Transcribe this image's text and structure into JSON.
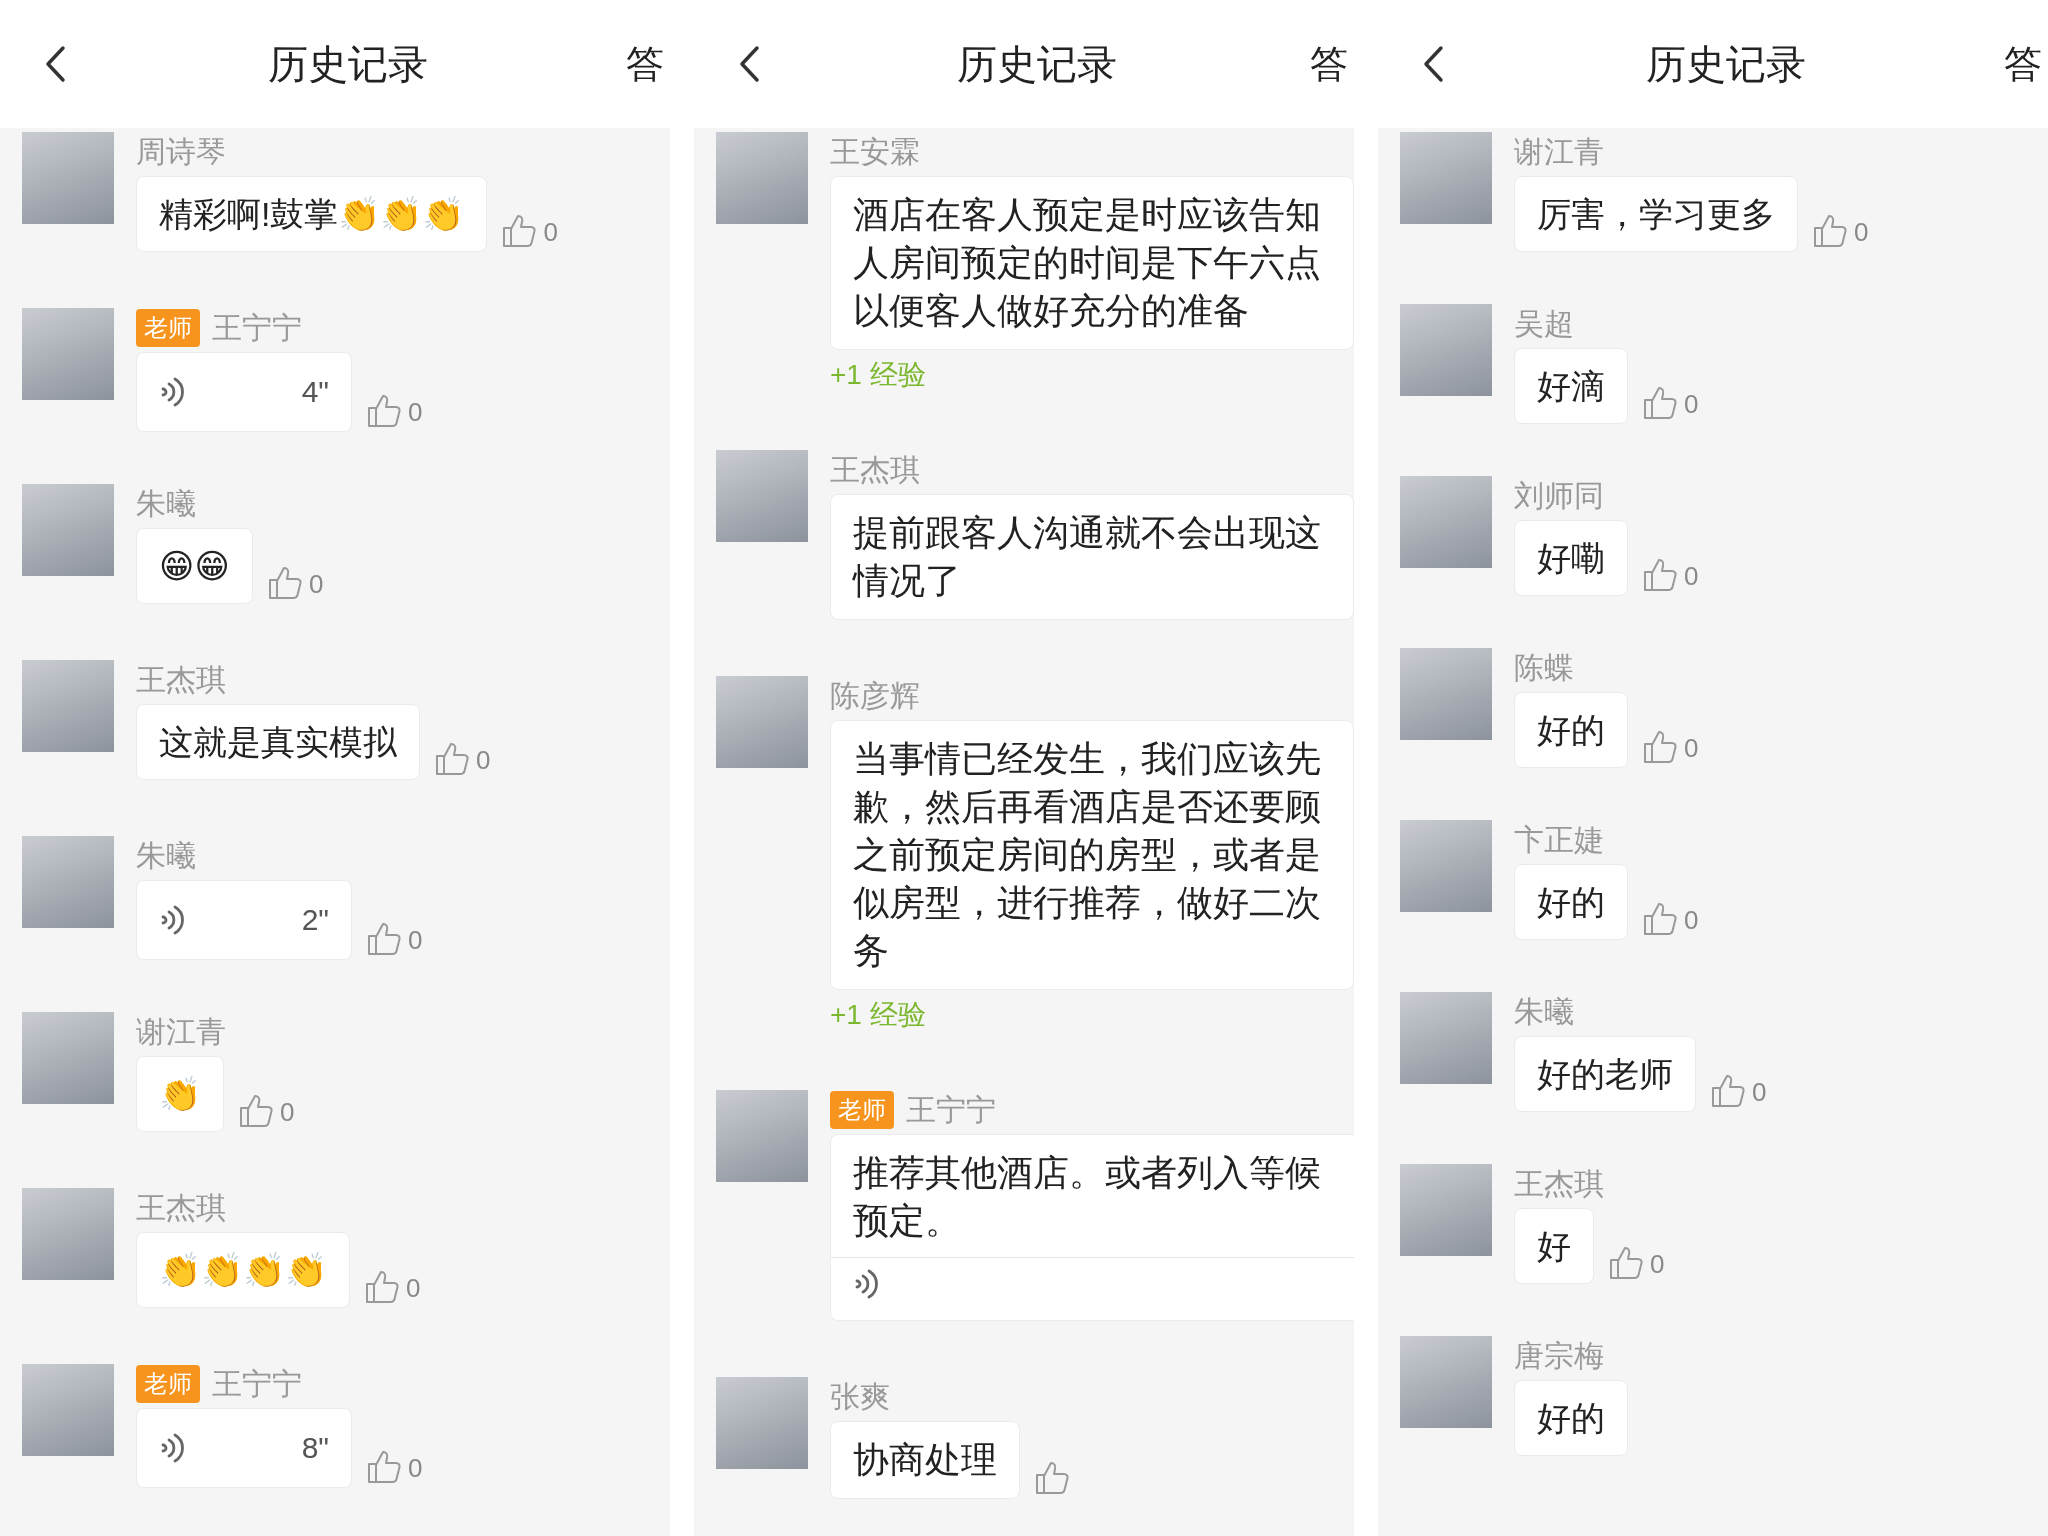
{
  "panels": [
    {
      "title": "历史记录",
      "tab": "答",
      "comments": [
        {
          "name": "周诗琴",
          "kind": "text",
          "text": "精彩啊!鼓掌👏👏👏",
          "like": true,
          "like_count": "0"
        },
        {
          "name": "王宁宁",
          "badge": "老师",
          "kind": "voice",
          "duration": "4\"",
          "like": true,
          "like_count": "0"
        },
        {
          "name": "朱曦",
          "kind": "text",
          "text": "😁😁",
          "like": true,
          "like_count": "0"
        },
        {
          "name": "王杰琪",
          "kind": "text",
          "text": "这就是真实模拟",
          "like": true,
          "like_count": "0"
        },
        {
          "name": "朱曦",
          "kind": "voice",
          "duration": "2\"",
          "like": true,
          "like_count": "0"
        },
        {
          "name": "谢江青",
          "kind": "text",
          "text": "👏",
          "like": true,
          "like_count": "0"
        },
        {
          "name": "王杰琪",
          "kind": "text",
          "text": "👏👏👏👏",
          "like": true,
          "like_count": "0"
        },
        {
          "name": "王宁宁",
          "badge": "老师",
          "kind": "voice",
          "duration": "8\"",
          "like": true,
          "like_count": "0"
        }
      ]
    },
    {
      "title": "历史记录",
      "tab": "答",
      "comments": [
        {
          "name": "王安霖",
          "kind": "text",
          "text": "酒店在客人预定是时应该告知人房间预定的时间是下午六点以便客人做好充分的准备",
          "bonus": "+1 经验",
          "like": false
        },
        {
          "name": "王杰琪",
          "kind": "text",
          "text": "提前跟客人沟通就不会出现这情况了",
          "like": false
        },
        {
          "name": "陈彦辉",
          "kind": "text",
          "text": "当事情已经发生，我们应该先歉，然后再看酒店是否还要顾之前预定房间的房型，或者是似房型，进行推荐，做好二次务",
          "bonus": "+1 经验",
          "like": false
        },
        {
          "name": "王宁宁",
          "badge": "老师",
          "kind": "text_voice",
          "text": "推荐其他酒店。或者列入等候预定。",
          "like": false
        },
        {
          "name": "张爽",
          "kind": "text",
          "text": "协商处理",
          "like": true
        }
      ]
    },
    {
      "title": "历史记录",
      "tab": "答",
      "comments": [
        {
          "name": "谢江青",
          "kind": "text",
          "text": "厉害，学习更多",
          "like": true,
          "like_count": "0"
        },
        {
          "name": "吴超",
          "kind": "text",
          "text": "好滴",
          "like": true,
          "like_count": "0"
        },
        {
          "name": "刘师同",
          "kind": "text",
          "text": "好嘞",
          "like": true,
          "like_count": "0"
        },
        {
          "name": "陈蝶",
          "kind": "text",
          "text": "好的",
          "like": true,
          "like_count": "0"
        },
        {
          "name": "卞正婕",
          "kind": "text",
          "text": "好的",
          "like": true,
          "like_count": "0"
        },
        {
          "name": "朱曦",
          "kind": "text",
          "text": "好的老师",
          "like": true,
          "like_count": "0"
        },
        {
          "name": "王杰琪",
          "kind": "text",
          "text": "好",
          "like": true,
          "like_count": "0"
        },
        {
          "name": "唐宗梅",
          "kind": "text",
          "text": "好的",
          "like": false
        }
      ]
    }
  ]
}
